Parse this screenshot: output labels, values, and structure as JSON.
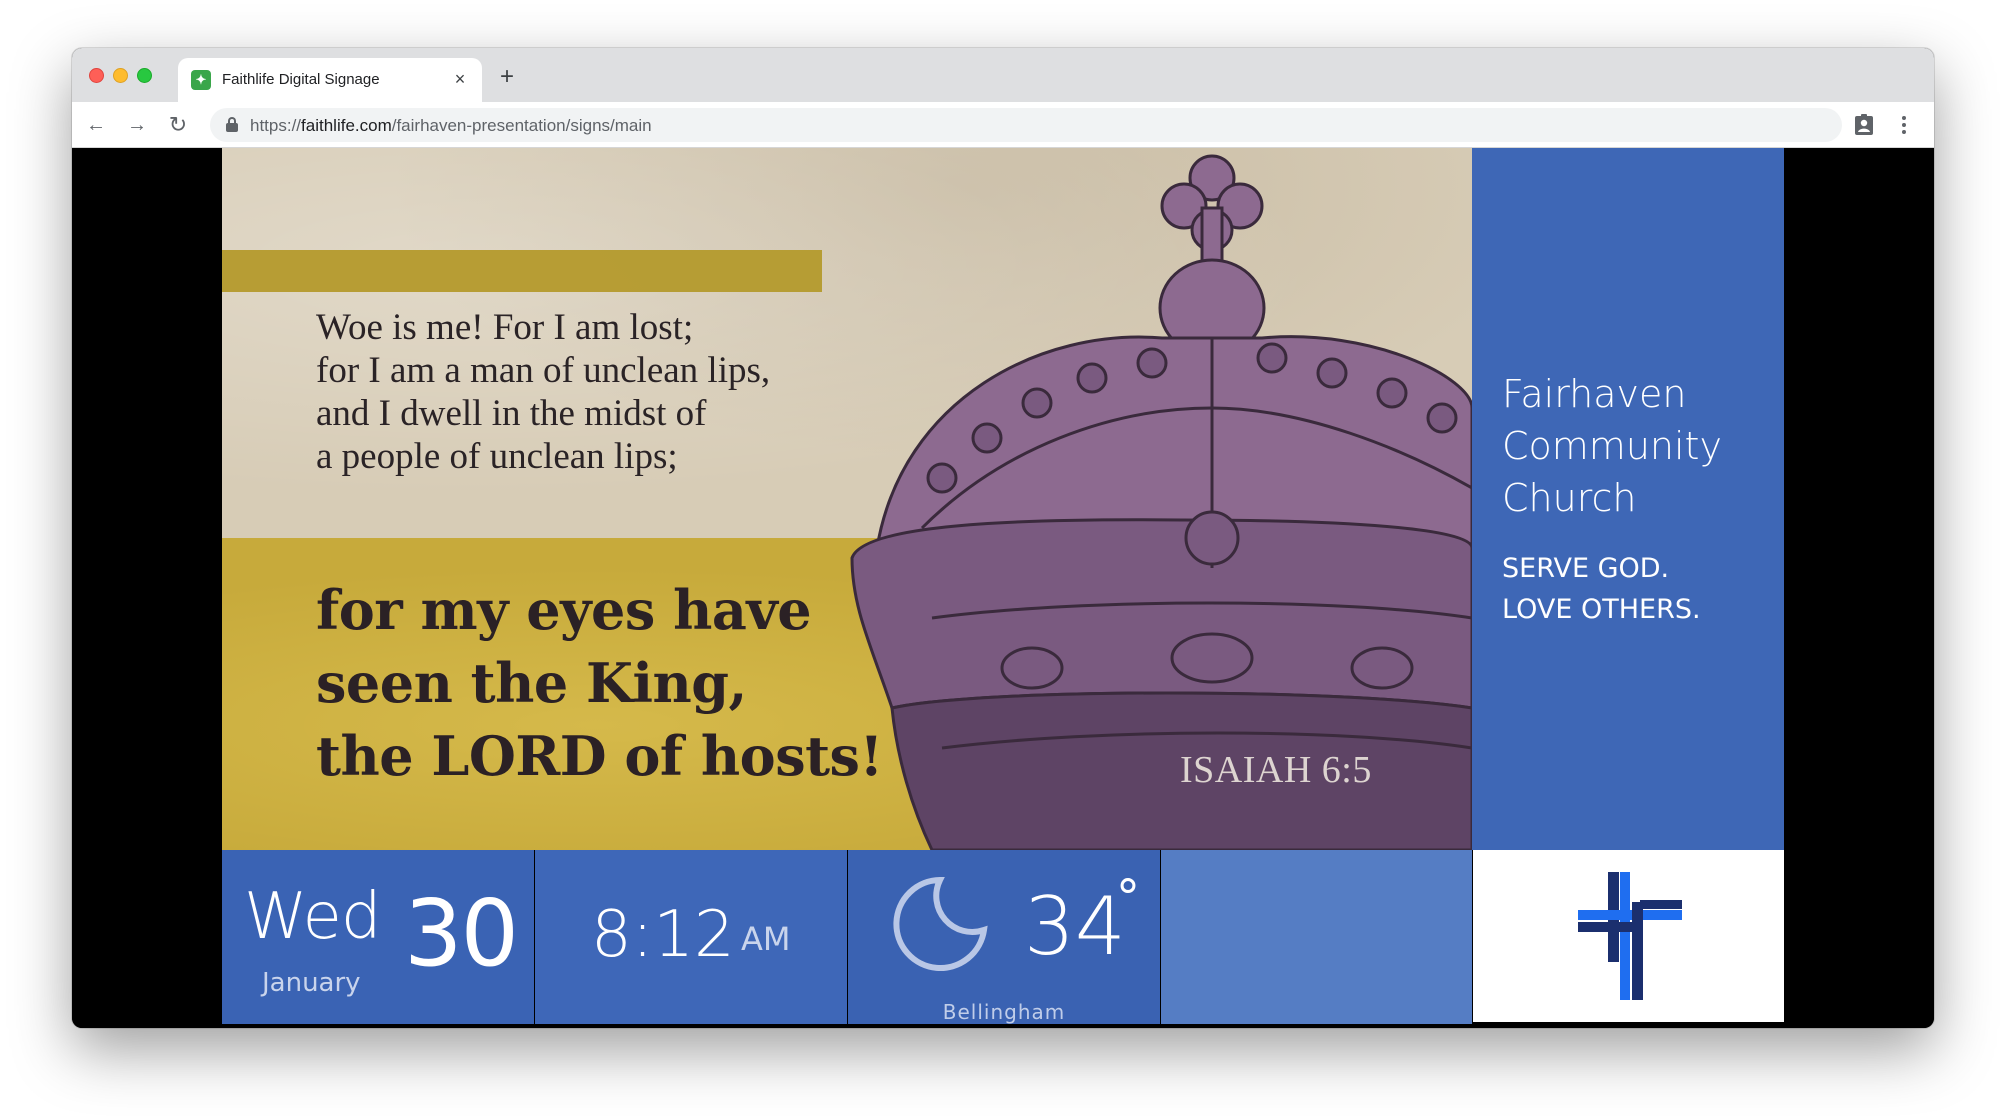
{
  "browser": {
    "tab_title": "Faithlife Digital Signage",
    "tab_close": "×",
    "new_tab": "+",
    "url_scheme": "https://",
    "url_host": "faithlife.com",
    "url_path": "/fairhaven-presentation/signs/main",
    "nav": {
      "back": "←",
      "forward": "→",
      "reload": "↻"
    }
  },
  "slide": {
    "verse_small": [
      "Woe is me! For I am lost;",
      "for I am a man of unclean lips,",
      "and I dwell in the midst of",
      "a people of unclean lips;"
    ],
    "verse_big": [
      "for my eyes have",
      "seen the King,",
      "the LORD of hosts!"
    ],
    "reference": "ISAIAH 6:5"
  },
  "church": {
    "name_lines": [
      "Fairhaven",
      "Community",
      "Church"
    ],
    "tagline_lines": [
      "SERVE GOD.",
      "LOVE OTHERS."
    ]
  },
  "widgets": {
    "date": {
      "day_name": "Wed",
      "day_number": "30",
      "month": "January"
    },
    "time": {
      "clock": "8:12",
      "ampm": "AM"
    },
    "weather": {
      "icon": "moon-icon",
      "temperature": "34",
      "degree_symbol": "°",
      "city": "Bellingham"
    }
  },
  "colors": {
    "church_panel": "#3e67b6",
    "widget_blue": "#3a63b4",
    "gold": "#c7aa3b",
    "crown_purple": "#8d6a90"
  }
}
